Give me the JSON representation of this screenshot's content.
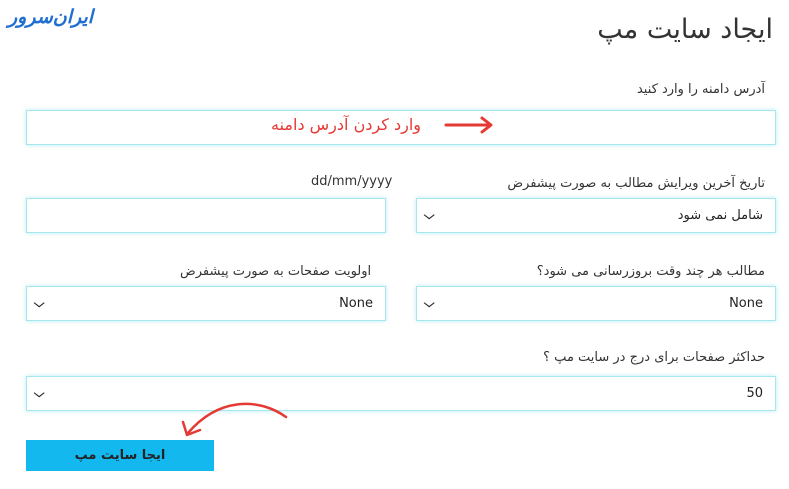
{
  "logo": {
    "text": "ایران‌سرور"
  },
  "page": {
    "title": "ایجاد سایت مپ"
  },
  "domain": {
    "label": "آدرس دامنه را وارد کنید",
    "value": "",
    "annotation": "وارد کردن آدرس دامنه"
  },
  "date_field": {
    "hint": "dd/mm/yyyy",
    "value": ""
  },
  "last_modified": {
    "label": "تاریخ آخرین ویرایش مطالب به صورت پیشفرض",
    "selected": "شامل نمی شود"
  },
  "change_frequency": {
    "label": "مطالب هر چند وقت بروزرسانی می شود؟",
    "selected": "None"
  },
  "priority": {
    "label": "اولویت صفحات به صورت پیشفرض",
    "selected": "None"
  },
  "max_pages": {
    "label": "حداکثر صفحات برای درج در سایت مپ ؟",
    "selected": "50"
  },
  "submit": {
    "label": "ایجا سایت مپ"
  },
  "colors": {
    "accent": "#13b8ee",
    "field_border": "#a8e6ee",
    "annotation": "#e53935",
    "logo": "#1e6fd0"
  },
  "icons": {
    "annotation_arrow": "arrow-right-icon",
    "button_arrow": "curved-arrow-icon",
    "select_chevron": "chevron-down-icon"
  }
}
